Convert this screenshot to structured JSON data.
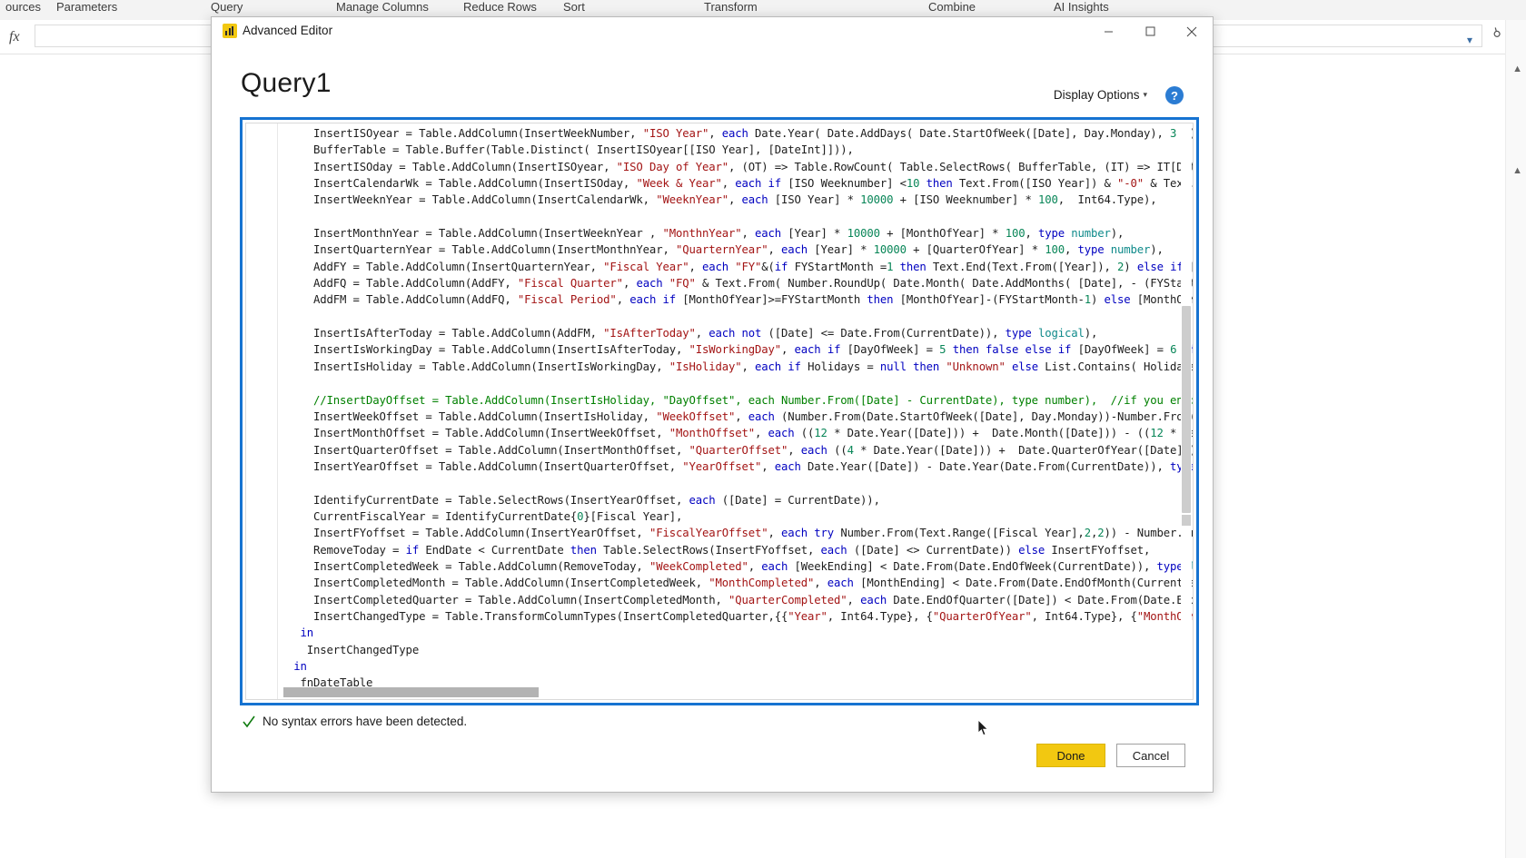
{
  "background": {
    "ribbon_groups": [
      "ources",
      "Parameters",
      "Query",
      "Manage Columns",
      "Reduce Rows",
      "Sort",
      "Transform",
      "Combine",
      "AI Insights"
    ],
    "formula_bar": {
      "fx_label": "fx",
      "value": "",
      "placeholder": "",
      "dropdown_icon": "chevron-down-icon"
    },
    "search_icon": "search-icon",
    "rail_icons": [
      "caret-up-icon",
      "caret-up-icon"
    ]
  },
  "dialog": {
    "titlebar": {
      "app_icon": "power-bi-icon",
      "title": "Advanced Editor",
      "minimize_label": "Minimize",
      "maximize_label": "Maximize",
      "close_label": "Close"
    },
    "heading": "Query1",
    "display_options": {
      "label": "Display Options",
      "chevron": "▾"
    },
    "help": {
      "label": "?",
      "icon": "help-icon"
    },
    "status": {
      "icon": "checkmark-icon",
      "text": "No syntax errors have been detected."
    },
    "buttons": {
      "done": "Done",
      "cancel": "Cancel"
    },
    "colors": {
      "focus_border": "#1673d1",
      "accent_yellow": "#f2c811",
      "help_blue": "#2b7cd3",
      "status_green": "#107c10"
    },
    "code_lines": [
      [
        {
          "t": "    InsertISOyear = Table.AddColumn(InsertWeekNumber, ",
          "c": "p"
        },
        {
          "t": "\"ISO Year\"",
          "c": "s"
        },
        {
          "t": ", ",
          "c": "p"
        },
        {
          "t": "each",
          "c": "k"
        },
        {
          "t": " Date.Year( Date.AddDays( Date.StartOfWeek([Date], Day.Monday), ",
          "c": "p"
        },
        {
          "t": "3",
          "c": "n"
        },
        {
          "t": " )),",
          "c": "p"
        }
      ],
      [
        {
          "t": "    BufferTable = Table.Buffer(Table.Distinct( InsertISOyear[[ISO Year], [DateInt]])),",
          "c": "p"
        }
      ],
      [
        {
          "t": "    InsertISOday = Table.AddColumn(InsertISOyear, ",
          "c": "p"
        },
        {
          "t": "\"ISO Day of Year\"",
          "c": "s"
        },
        {
          "t": ", (OT) => Table.RowCount( Table.SelectRows( BufferTable, (IT) => IT[DateInt",
          "c": "p"
        }
      ],
      [
        {
          "t": "    InsertCalendarWk = Table.AddColumn(InsertISOday, ",
          "c": "p"
        },
        {
          "t": "\"Week & Year\"",
          "c": "s"
        },
        {
          "t": ", ",
          "c": "p"
        },
        {
          "t": "each",
          "c": "k"
        },
        {
          "t": " ",
          "c": "p"
        },
        {
          "t": "if",
          "c": "k"
        },
        {
          "t": " [ISO Weeknumber] <",
          "c": "p"
        },
        {
          "t": "10",
          "c": "n"
        },
        {
          "t": " ",
          "c": "p"
        },
        {
          "t": "then",
          "c": "k"
        },
        {
          "t": " Text.From([ISO Year]) & ",
          "c": "p"
        },
        {
          "t": "\"-0\"",
          "c": "s"
        },
        {
          "t": " & Text.Fro",
          "c": "p"
        }
      ],
      [
        {
          "t": "    InsertWeeknYear = Table.AddColumn(InsertCalendarWk, ",
          "c": "p"
        },
        {
          "t": "\"WeeknYear\"",
          "c": "s"
        },
        {
          "t": ", ",
          "c": "p"
        },
        {
          "t": "each",
          "c": "k"
        },
        {
          "t": " [ISO Year] * ",
          "c": "p"
        },
        {
          "t": "10000",
          "c": "n"
        },
        {
          "t": " + [ISO Weeknumber] * ",
          "c": "p"
        },
        {
          "t": "100",
          "c": "n"
        },
        {
          "t": ",  Int64.Type),",
          "c": "p"
        }
      ],
      [],
      [
        {
          "t": "    InsertMonthnYear = Table.AddColumn(InsertWeeknYear , ",
          "c": "p"
        },
        {
          "t": "\"MonthnYear\"",
          "c": "s"
        },
        {
          "t": ", ",
          "c": "p"
        },
        {
          "t": "each",
          "c": "k"
        },
        {
          "t": " [Year] * ",
          "c": "p"
        },
        {
          "t": "10000",
          "c": "n"
        },
        {
          "t": " + [MonthOfYear] * ",
          "c": "p"
        },
        {
          "t": "100",
          "c": "n"
        },
        {
          "t": ", ",
          "c": "p"
        },
        {
          "t": "type",
          "c": "k"
        },
        {
          "t": " ",
          "c": "p"
        },
        {
          "t": "number",
          "c": "t"
        },
        {
          "t": "),",
          "c": "p"
        }
      ],
      [
        {
          "t": "    InsertQuarternYear = Table.AddColumn(InsertMonthnYear, ",
          "c": "p"
        },
        {
          "t": "\"QuarternYear\"",
          "c": "s"
        },
        {
          "t": ", ",
          "c": "p"
        },
        {
          "t": "each",
          "c": "k"
        },
        {
          "t": " [Year] * ",
          "c": "p"
        },
        {
          "t": "10000",
          "c": "n"
        },
        {
          "t": " + [QuarterOfYear] * ",
          "c": "p"
        },
        {
          "t": "100",
          "c": "n"
        },
        {
          "t": ", ",
          "c": "p"
        },
        {
          "t": "type",
          "c": "k"
        },
        {
          "t": " ",
          "c": "p"
        },
        {
          "t": "number",
          "c": "t"
        },
        {
          "t": "),",
          "c": "p"
        }
      ],
      [
        {
          "t": "    AddFY = Table.AddColumn(InsertQuarternYear, ",
          "c": "p"
        },
        {
          "t": "\"Fiscal Year\"",
          "c": "s"
        },
        {
          "t": ", ",
          "c": "p"
        },
        {
          "t": "each",
          "c": "k"
        },
        {
          "t": " ",
          "c": "p"
        },
        {
          "t": "\"FY\"",
          "c": "s"
        },
        {
          "t": "&(",
          "c": "p"
        },
        {
          "t": "if",
          "c": "k"
        },
        {
          "t": " FYStartMonth =",
          "c": "p"
        },
        {
          "t": "1",
          "c": "n"
        },
        {
          "t": " ",
          "c": "p"
        },
        {
          "t": "then",
          "c": "k"
        },
        {
          "t": " Text.End(Text.From([Year]), ",
          "c": "p"
        },
        {
          "t": "2",
          "c": "n"
        },
        {
          "t": ") ",
          "c": "p"
        },
        {
          "t": "else",
          "c": "k"
        },
        {
          "t": " ",
          "c": "p"
        },
        {
          "t": "if",
          "c": "k"
        },
        {
          "t": " [Mon",
          "c": "p"
        }
      ],
      [
        {
          "t": "    AddFQ = Table.AddColumn(AddFY, ",
          "c": "p"
        },
        {
          "t": "\"Fiscal Quarter\"",
          "c": "s"
        },
        {
          "t": ", ",
          "c": "p"
        },
        {
          "t": "each",
          "c": "k"
        },
        {
          "t": " ",
          "c": "p"
        },
        {
          "t": "\"FQ\"",
          "c": "s"
        },
        {
          "t": " & Text.From( Number.RoundUp( Date.Month( Date.AddMonths( [Date], - (FYStartMont",
          "c": "p"
        }
      ],
      [
        {
          "t": "    AddFM = Table.AddColumn(AddFQ, ",
          "c": "p"
        },
        {
          "t": "\"Fiscal Period\"",
          "c": "s"
        },
        {
          "t": ", ",
          "c": "p"
        },
        {
          "t": "each",
          "c": "k"
        },
        {
          "t": " ",
          "c": "p"
        },
        {
          "t": "if",
          "c": "k"
        },
        {
          "t": " [MonthOfYear]>=FYStartMonth ",
          "c": "p"
        },
        {
          "t": "then",
          "c": "k"
        },
        {
          "t": " [MonthOfYear]-(FYStartMonth-",
          "c": "p"
        },
        {
          "t": "1",
          "c": "n"
        },
        {
          "t": ") ",
          "c": "p"
        },
        {
          "t": "else",
          "c": "k"
        },
        {
          "t": " [MonthOfYear",
          "c": "p"
        }
      ],
      [],
      [
        {
          "t": "    InsertIsAfterToday = Table.AddColumn(AddFM, ",
          "c": "p"
        },
        {
          "t": "\"IsAfterToday\"",
          "c": "s"
        },
        {
          "t": ", ",
          "c": "p"
        },
        {
          "t": "each",
          "c": "k"
        },
        {
          "t": " ",
          "c": "p"
        },
        {
          "t": "not",
          "c": "k"
        },
        {
          "t": " ([Date] <= Date.From(CurrentDate)), ",
          "c": "p"
        },
        {
          "t": "type",
          "c": "k"
        },
        {
          "t": " ",
          "c": "p"
        },
        {
          "t": "logical",
          "c": "t"
        },
        {
          "t": "),",
          "c": "p"
        }
      ],
      [
        {
          "t": "    InsertIsWorkingDay = Table.AddColumn(InsertIsAfterToday, ",
          "c": "p"
        },
        {
          "t": "\"IsWorkingDay\"",
          "c": "s"
        },
        {
          "t": ", ",
          "c": "p"
        },
        {
          "t": "each",
          "c": "k"
        },
        {
          "t": " ",
          "c": "p"
        },
        {
          "t": "if",
          "c": "k"
        },
        {
          "t": " [DayOfWeek] = ",
          "c": "p"
        },
        {
          "t": "5",
          "c": "n"
        },
        {
          "t": " ",
          "c": "p"
        },
        {
          "t": "then",
          "c": "k"
        },
        {
          "t": " ",
          "c": "p"
        },
        {
          "t": "false",
          "c": "k"
        },
        {
          "t": " ",
          "c": "p"
        },
        {
          "t": "else",
          "c": "k"
        },
        {
          "t": " ",
          "c": "p"
        },
        {
          "t": "if",
          "c": "k"
        },
        {
          "t": " [DayOfWeek] = ",
          "c": "p"
        },
        {
          "t": "6",
          "c": "n"
        },
        {
          "t": " ",
          "c": "p"
        },
        {
          "t": "then",
          "c": "k"
        }
      ],
      [
        {
          "t": "    InsertIsHoliday = Table.AddColumn(InsertIsWorkingDay, ",
          "c": "p"
        },
        {
          "t": "\"IsHoliday\"",
          "c": "s"
        },
        {
          "t": ", ",
          "c": "p"
        },
        {
          "t": "each",
          "c": "k"
        },
        {
          "t": " ",
          "c": "p"
        },
        {
          "t": "if",
          "c": "k"
        },
        {
          "t": " Holidays = ",
          "c": "p"
        },
        {
          "t": "null",
          "c": "k"
        },
        {
          "t": " ",
          "c": "p"
        },
        {
          "t": "then",
          "c": "k"
        },
        {
          "t": " ",
          "c": "p"
        },
        {
          "t": "\"Unknown\"",
          "c": "s"
        },
        {
          "t": " ",
          "c": "p"
        },
        {
          "t": "else",
          "c": "k"
        },
        {
          "t": " List.Contains( Holidays, [",
          "c": "p"
        }
      ],
      [],
      [
        {
          "t": "    //InsertDayOffset = Table.AddColumn(InsertIsHoliday, \"DayOffset\", each Number.From([Date] - CurrentDate), type number),  //if you enable ",
          "c": "c"
        }
      ],
      [
        {
          "t": "    InsertWeekOffset = Table.AddColumn(InsertIsHoliday, ",
          "c": "p"
        },
        {
          "t": "\"WeekOffset\"",
          "c": "s"
        },
        {
          "t": ", ",
          "c": "p"
        },
        {
          "t": "each",
          "c": "k"
        },
        {
          "t": " (Number.From(Date.StartOfWeek([Date], Day.Monday))-Number.From(Dat",
          "c": "p"
        }
      ],
      [
        {
          "t": "    InsertMonthOffset = Table.AddColumn(InsertWeekOffset, ",
          "c": "p"
        },
        {
          "t": "\"MonthOffset\"",
          "c": "s"
        },
        {
          "t": ", ",
          "c": "p"
        },
        {
          "t": "each",
          "c": "k"
        },
        {
          "t": " ((",
          "c": "p"
        },
        {
          "t": "12",
          "c": "n"
        },
        {
          "t": " * Date.Year([Date])) +  Date.Month([Date])) - ((",
          "c": "p"
        },
        {
          "t": "12",
          "c": "n"
        },
        {
          "t": " * Date.",
          "c": "p"
        }
      ],
      [
        {
          "t": "    InsertQuarterOffset = Table.AddColumn(InsertMonthOffset, ",
          "c": "p"
        },
        {
          "t": "\"QuarterOffset\"",
          "c": "s"
        },
        {
          "t": ", ",
          "c": "p"
        },
        {
          "t": "each",
          "c": "k"
        },
        {
          "t": " ((",
          "c": "p"
        },
        {
          "t": "4",
          "c": "n"
        },
        {
          "t": " * Date.Year([Date])) +  Date.QuarterOfYear([Date])) -",
          "c": "p"
        }
      ],
      [
        {
          "t": "    InsertYearOffset = Table.AddColumn(InsertQuarterOffset, ",
          "c": "p"
        },
        {
          "t": "\"YearOffset\"",
          "c": "s"
        },
        {
          "t": ", ",
          "c": "p"
        },
        {
          "t": "each",
          "c": "k"
        },
        {
          "t": " Date.Year([Date]) - Date.Year(Date.From(CurrentDate)), ",
          "c": "p"
        },
        {
          "t": "type",
          "c": "k"
        },
        {
          "t": " ",
          "c": "p"
        },
        {
          "t": "nu",
          "c": "t"
        }
      ],
      [],
      [
        {
          "t": "    IdentifyCurrentDate = Table.SelectRows(InsertYearOffset, ",
          "c": "p"
        },
        {
          "t": "each",
          "c": "k"
        },
        {
          "t": " ([Date] = CurrentDate)),",
          "c": "p"
        }
      ],
      [
        {
          "t": "    CurrentFiscalYear = IdentifyCurrentDate{",
          "c": "p"
        },
        {
          "t": "0",
          "c": "n"
        },
        {
          "t": "}[Fiscal Year],",
          "c": "p"
        }
      ],
      [
        {
          "t": "    InsertFYoffset = Table.AddColumn(InsertYearOffset, ",
          "c": "p"
        },
        {
          "t": "\"FiscalYearOffset\"",
          "c": "s"
        },
        {
          "t": ", ",
          "c": "p"
        },
        {
          "t": "each",
          "c": "k"
        },
        {
          "t": " ",
          "c": "p"
        },
        {
          "t": "try",
          "c": "k"
        },
        {
          "t": " Number.From(Text.Range([Fiscal Year],",
          "c": "p"
        },
        {
          "t": "2",
          "c": "n"
        },
        {
          "t": ",",
          "c": "p"
        },
        {
          "t": "2",
          "c": "n"
        },
        {
          "t": ")) - Number.From(",
          "c": "p"
        }
      ],
      [
        {
          "t": "    RemoveToday = ",
          "c": "p"
        },
        {
          "t": "if",
          "c": "k"
        },
        {
          "t": " EndDate < CurrentDate ",
          "c": "p"
        },
        {
          "t": "then",
          "c": "k"
        },
        {
          "t": " Table.SelectRows(InsertFYoffset, ",
          "c": "p"
        },
        {
          "t": "each",
          "c": "k"
        },
        {
          "t": " ([Date] <> CurrentDate)) ",
          "c": "p"
        },
        {
          "t": "else",
          "c": "k"
        },
        {
          "t": " InsertFYoffset,",
          "c": "p"
        }
      ],
      [
        {
          "t": "    InsertCompletedWeek = Table.AddColumn(RemoveToday, ",
          "c": "p"
        },
        {
          "t": "\"WeekCompleted\"",
          "c": "s"
        },
        {
          "t": ", ",
          "c": "p"
        },
        {
          "t": "each",
          "c": "k"
        },
        {
          "t": " [WeekEnding] < Date.From(Date.EndOfWeek(CurrentDate)), ",
          "c": "p"
        },
        {
          "t": "type",
          "c": "k"
        },
        {
          "t": " ",
          "c": "p"
        },
        {
          "t": "logi",
          "c": "t"
        }
      ],
      [
        {
          "t": "    InsertCompletedMonth = Table.AddColumn(InsertCompletedWeek, ",
          "c": "p"
        },
        {
          "t": "\"MonthCompleted\"",
          "c": "s"
        },
        {
          "t": ", ",
          "c": "p"
        },
        {
          "t": "each",
          "c": "k"
        },
        {
          "t": " [MonthEnding] < Date.From(Date.EndOfMonth(CurrentDate)",
          "c": "p"
        }
      ],
      [
        {
          "t": "    InsertCompletedQuarter = Table.AddColumn(InsertCompletedMonth, ",
          "c": "p"
        },
        {
          "t": "\"QuarterCompleted\"",
          "c": "s"
        },
        {
          "t": ", ",
          "c": "p"
        },
        {
          "t": "each",
          "c": "k"
        },
        {
          "t": " Date.EndOfQuarter([Date]) < Date.From(Date.EndOfQ",
          "c": "p"
        }
      ],
      [
        {
          "t": "    InsertChangedType = Table.TransformColumnTypes(InsertCompletedQuarter,{{",
          "c": "p"
        },
        {
          "t": "\"Year\"",
          "c": "s"
        },
        {
          "t": ", Int64.Type}, {",
          "c": "p"
        },
        {
          "t": "\"QuarterOfYear\"",
          "c": "s"
        },
        {
          "t": ", Int64.Type}, {",
          "c": "p"
        },
        {
          "t": "\"MonthOfYear",
          "c": "s"
        }
      ],
      [
        {
          "t": "  ",
          "c": "p"
        },
        {
          "t": "in",
          "c": "k"
        }
      ],
      [
        {
          "t": "   InsertChangedType",
          "c": "p"
        }
      ],
      [
        {
          "t": " ",
          "c": "p"
        },
        {
          "t": "in",
          "c": "k"
        }
      ],
      [
        {
          "t": "  fnDateTable",
          "c": "p"
        }
      ]
    ]
  }
}
